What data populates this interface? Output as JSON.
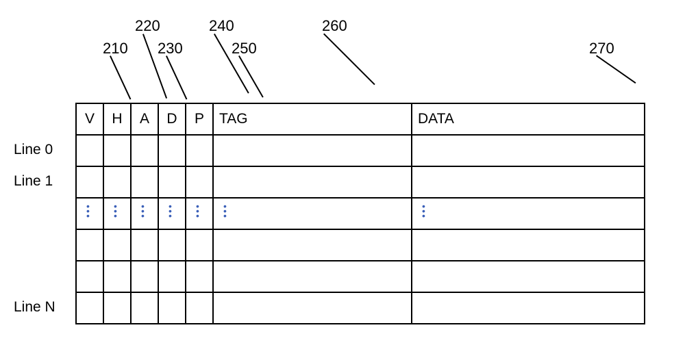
{
  "callouts": {
    "c210": "210",
    "c220": "220",
    "c230": "230",
    "c240": "240",
    "c250": "250",
    "c260": "260",
    "c270": "270"
  },
  "headers": {
    "col_v": "V",
    "col_h": "H",
    "col_a": "A",
    "col_d": "D",
    "col_p": "P",
    "col_tag": "TAG",
    "col_data": "DATA"
  },
  "row_labels": {
    "line0": "Line 0",
    "line1": "Line 1",
    "lineN": "Line N"
  }
}
